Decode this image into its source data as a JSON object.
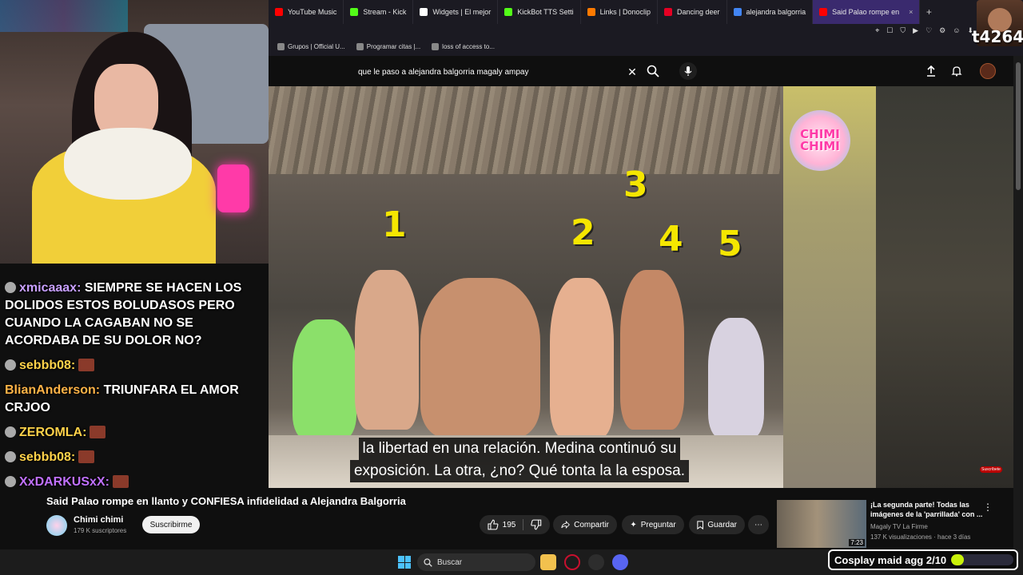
{
  "browser": {
    "tabs": [
      {
        "label": "YouTube Music",
        "color": "#ff0000"
      },
      {
        "label": "Stream - Kick",
        "color": "#53fc18"
      },
      {
        "label": "Widgets | El mejor",
        "color": "#ffffff"
      },
      {
        "label": "KickBot TTS Setti",
        "color": "#53fc18"
      },
      {
        "label": "Links | Donoclip",
        "color": "#ff7a00"
      },
      {
        "label": "Dancing deer",
        "color": "#e60023"
      },
      {
        "label": "alejandra balgorria",
        "color": "#4285f4"
      },
      {
        "label": "Said Palao rompe en",
        "color": "#ff0000",
        "active": true
      }
    ],
    "new_tab": "+",
    "bookmarks": [
      "Grupos | Official U...",
      "Programar citas |...",
      "loss of access to..."
    ]
  },
  "youtube": {
    "search_query": "que le paso a alejandra balgorria magaly ampay",
    "clear_glyph": "✕",
    "video": {
      "channel_logo_text": [
        "CHIMI",
        "CHIMI"
      ],
      "numbers": [
        "1",
        "2",
        "3",
        "4",
        "5"
      ],
      "subtitle_lines": [
        "la libertad en una relación. Medina continuó su",
        "exposición. La otra, ¿no? Qué tonta la la esposa."
      ],
      "subscribe_overlay": "Suscríbete"
    },
    "title": "Said Palao rompe en llanto y CONFIESA infidelidad a Alejandra Balgorria",
    "channel": {
      "name": "Chimi chimi",
      "subscribers": "179 K suscriptores"
    },
    "subscribe_label": "Suscribirme",
    "actions": {
      "likes": "195",
      "share": "Compartir",
      "ask": "Preguntar",
      "save": "Guardar",
      "more": "⋯"
    },
    "related": {
      "title": "¡La segunda parte! Todas las imágenes de la 'parrillada' con ...",
      "channel": "Magaly TV La Firme",
      "stats": "137 K visualizaciones · hace 3 días",
      "duration": "7:23"
    }
  },
  "chat": [
    {
      "user": "xmicaaax:",
      "color": "#c8a0ff",
      "badge": true,
      "msg": "SIEMPRE SE HACEN LOS DOLIDOS ESTOS BOLUDASOS PERO CUANDO LA CAGABAN NO SE ACORDABA DE SU DOLOR NO?",
      "emote": false
    },
    {
      "user": "sebbb08:",
      "color": "#ffd24a",
      "badge": true,
      "msg": "",
      "emote": true
    },
    {
      "user": "BlianAnderson:",
      "color": "#ffb347",
      "badge": false,
      "msg": "TRIUNFARA EL AMOR CRJOO",
      "emote": false
    },
    {
      "user": "ZEROMLA:",
      "color": "#ffd24a",
      "badge": true,
      "msg": "",
      "emote": true
    },
    {
      "user": "sebbb08:",
      "color": "#ffd24a",
      "badge": true,
      "msg": "",
      "emote": true
    },
    {
      "user": "XxDARKUSxX:",
      "color": "#c070ff",
      "badge": true,
      "msg": "",
      "emote": true
    }
  ],
  "overlay": {
    "streamer_tag": "t4264",
    "goal_label": "Cosplay maid agg 2/10",
    "goal_progress": 0.2
  },
  "taskbar": {
    "search_placeholder": "Buscar"
  }
}
